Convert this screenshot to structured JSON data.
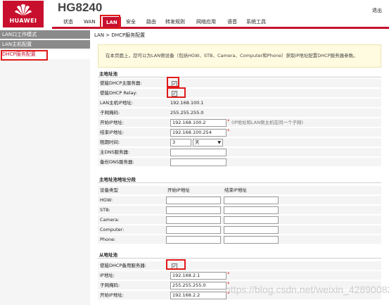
{
  "header": {
    "brand": "HUAWEI",
    "model": "HG8240",
    "exit_label": "退出",
    "nav": [
      "状态",
      "WAN",
      "LAN",
      "安全",
      "路由",
      "转发规则",
      "网络应用",
      "语音",
      "系统工具"
    ],
    "active_nav": "LAN"
  },
  "sidebar": {
    "items": [
      {
        "label": "LAN口工作模式"
      },
      {
        "label": "LAN主机配置"
      },
      {
        "label": "DHCP服务配置"
      }
    ]
  },
  "breadcrumb": "LAN > DHCP服务配置",
  "info_text": "在本页面上，您可以为LAN侧设备（包括HGW、STB、Camera、Computer和Phone）获取IP地址配置DHCP服务器参数。",
  "primary": {
    "title": "主地址池",
    "enable_server_label": "使能DHCP主服务器:",
    "enable_relay_label": "使能DHCP Relay:",
    "lan_ip_label": "LAN主机IP地址:",
    "lan_ip_value": "192.168.100.1",
    "mask_label": "子网掩码:",
    "mask_value": "255.255.255.0",
    "start_ip_label": "开始IP地址:",
    "start_ip_value": "192.168.100.2",
    "start_ip_hint": "(IP地址和LAN侧主机在同一个子网)",
    "end_ip_label": "结束IP地址:",
    "end_ip_value": "192.168.100.254",
    "lease_label": "租期时间:",
    "lease_value": "3",
    "lease_unit": "天",
    "dns1_label": "主DNS服务器:",
    "dns2_label": "备份DNS服务器:"
  },
  "pool": {
    "title": "主地址池地址分段",
    "col_device": "设备类型",
    "col_start": "开始IP地址",
    "col_end": "结束IP地址",
    "devices": [
      "HGW:",
      "STB:",
      "Camera:",
      "Computer:",
      "Phone:"
    ]
  },
  "secondary": {
    "title": "从地址池",
    "enable_label": "使能DHCP备用服务器:",
    "ip_label": "IP地址:",
    "ip_value": "192.168.2.1",
    "mask_label": "子网掩码:",
    "mask_value": "255.255.255.0",
    "start_label": "开始IP地址:",
    "start_value": "192.168.2.2"
  },
  "watermark": "https://blog.csdn.net/weixin_42890082",
  "colors": {
    "accent": "#c8102e",
    "highlight_box": "#e01a1a"
  }
}
